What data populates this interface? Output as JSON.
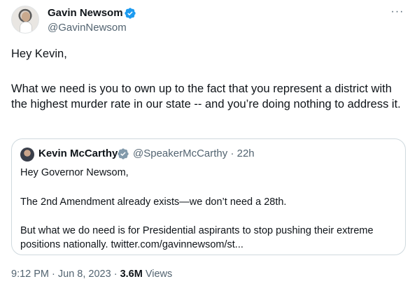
{
  "author": {
    "name": "Gavin Newsom",
    "handle": "@GavinNewsom",
    "avatar_icon": "profile-photo",
    "verified_icon": "verified-badge-icon"
  },
  "menu": {
    "more_label": "···"
  },
  "tweet": {
    "line1": "Hey Kevin,",
    "para2": "What we need is you to own up to the fact that you represent a district with the highest murder rate in our state -- and you’re doing nothing to address it."
  },
  "quote": {
    "name": "Kevin McCarthy",
    "handle_time": "@SpeakerMcCarthy · 22h",
    "lines": [
      "Hey Governor Newsom,",
      "The 2nd Amendment already exists—we don’t need a 28th.",
      "But what we do need is for Presidential aspirants to stop pushing their extreme",
      "positions nationally. twitter.com/gavinnewsom/st..."
    ]
  },
  "footer": {
    "datetime": "9:12 PM · Jun 8, 2023 · ",
    "views_count": "3.6M",
    "views_label": " Views"
  },
  "colors": {
    "verified_blue": "#1d9bf0",
    "secondary_text": "#536471",
    "border": "#cfd9de"
  }
}
